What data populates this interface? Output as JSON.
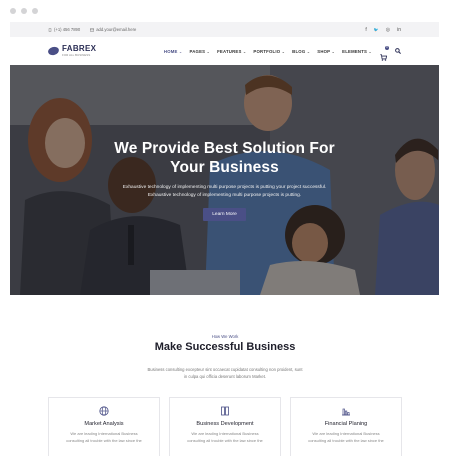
{
  "topbar": {
    "phone": "(+1) 456 7890",
    "email": "add.your@email.here",
    "social_icons": [
      "facebook-icon",
      "twitter-icon",
      "instagram-icon",
      "linkedin-icon"
    ],
    "social_glyphs": [
      "f",
      "🐦",
      "◎",
      "in"
    ]
  },
  "brand": {
    "name": "FABREX",
    "tagline": "FOR ALL BUSINESS",
    "accent": "#4a4f86"
  },
  "nav": {
    "items": [
      {
        "label": "HOME",
        "active": true
      },
      {
        "label": "PAGES",
        "active": false
      },
      {
        "label": "FEATURES",
        "active": false
      },
      {
        "label": "PORTFOLIO",
        "active": false
      },
      {
        "label": "BLOG",
        "active": false
      },
      {
        "label": "SHOP",
        "active": false
      },
      {
        "label": "ELEMENTS",
        "active": false
      }
    ],
    "cart_count": "0"
  },
  "hero": {
    "title_line1": "We Provide Best Solution For",
    "title_line2": "Your Business",
    "subtitle_line1": "Exhaustive technology of implementing multi purpose projects is putting your project successful.",
    "subtitle_line2": "Exhaustive technology of implementing multi purpose projects is putting.",
    "button_label": "Learn More"
  },
  "section": {
    "eyebrow": "How We Work",
    "title": "Make Successful Business",
    "desc_line1": "Business consulting excepteur sint occaecat cupidatat consulting non proident, sunt",
    "desc_line2": "in culpa qui officia deserunt laborum Market."
  },
  "cards": [
    {
      "icon": "globe-icon",
      "title": "Market Analysis",
      "text_line1": "We are leading International Business",
      "text_line2": "consulting all trouble with the law since the"
    },
    {
      "icon": "documents-icon",
      "title": "Business Development",
      "text_line1": "We are leading International Business",
      "text_line2": "consulting all trouble with the law since the"
    },
    {
      "icon": "bar-chart-icon",
      "title": "Financial Planing",
      "text_line1": "We are leading International Business",
      "text_line2": "consulting all trouble with the law since the"
    }
  ]
}
